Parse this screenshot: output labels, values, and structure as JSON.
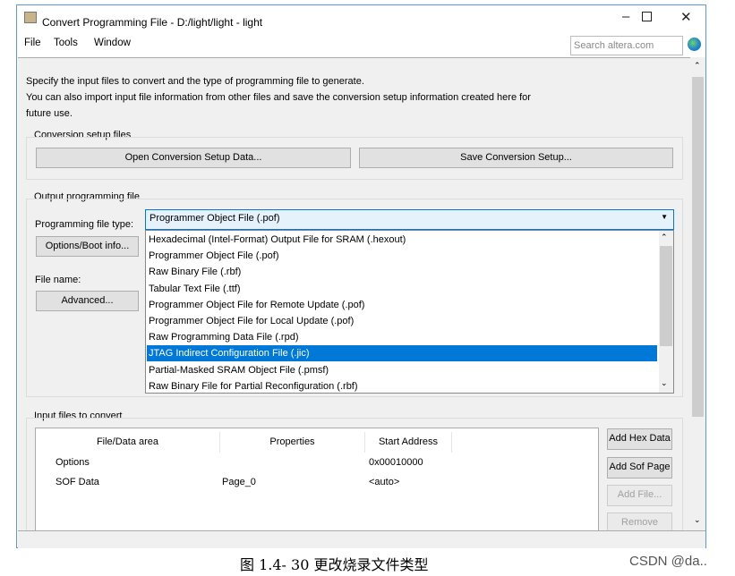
{
  "window": {
    "title": "Convert Programming File - D:/light/light - light"
  },
  "menu": [
    "File",
    "Tools",
    "Window"
  ],
  "search": {
    "placeholder": "Search altera.com"
  },
  "intro": {
    "line1": "Specify the input files to convert and the type of programming file to generate.",
    "line2": "You can also import input file information from other files and save the conversion setup information created here for",
    "line3": "future use."
  },
  "setup": {
    "label": "Conversion setup files",
    "open": "Open Conversion Setup Data...",
    "save": "Save Conversion Setup..."
  },
  "output": {
    "label": "Output programming file",
    "type_label": "Programming file type:",
    "type_value": "Programmer Object File (.pof)",
    "options_btn": "Options/Boot info...",
    "file_name_label": "File name:",
    "advanced_btn": "Advanced...",
    "options": [
      "Hexadecimal (Intel-Format) Output File for SRAM (.hexout)",
      "Programmer Object File (.pof)",
      "Raw Binary File (.rbf)",
      "Tabular Text File (.ttf)",
      "Programmer Object File for Remote Update (.pof)",
      "Programmer Object File for Local Update (.pof)",
      "Raw Programming Data File (.rpd)",
      "JTAG Indirect Configuration File (.jic)",
      "Partial-Masked SRAM Object File (.pmsf)",
      "Raw Binary File for Partial Reconfiguration (.rbf)"
    ],
    "highlighted": "JTAG Indirect Configuration File (.jic)"
  },
  "input": {
    "label": "Input files to convert",
    "columns": [
      "File/Data area",
      "Properties",
      "Start Address"
    ],
    "rows": [
      [
        "Options",
        "",
        "0x00010000"
      ],
      [
        "SOF Data",
        "Page_0",
        "<auto>"
      ]
    ],
    "buttons": {
      "add_hex": "Add Hex Data",
      "add_sof": "Add Sof Page",
      "add_file": "Add File...",
      "remove": "Remove"
    }
  },
  "caption": "图 1.4- 30 更改烧录文件类型",
  "watermark": "CSDN @da.."
}
